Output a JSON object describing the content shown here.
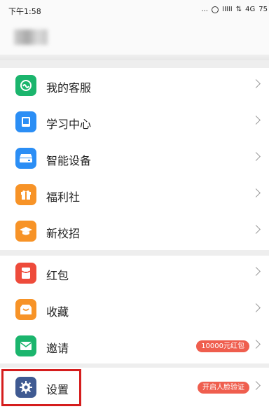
{
  "status_bar": {
    "time": "下午1:58",
    "dots": "...",
    "signal": "IIIII",
    "data_arrows": "⇅",
    "network": "4G",
    "battery": "75"
  },
  "menu": {
    "group1": [
      {
        "label": "我的客服",
        "icon": "customer-service-icon",
        "color": "#1bb56d"
      },
      {
        "label": "学习中心",
        "icon": "book-icon",
        "color": "#2b8ef5"
      },
      {
        "label": "智能设备",
        "icon": "device-icon",
        "color": "#2b8ef5"
      },
      {
        "label": "福利社",
        "icon": "gift-icon",
        "color": "#f79327"
      },
      {
        "label": "新校招",
        "icon": "graduation-cap-icon",
        "color": "#f79327"
      }
    ],
    "group2": [
      {
        "label": "红包",
        "icon": "red-packet-icon",
        "color": "#ee4b3b"
      },
      {
        "label": "收藏",
        "icon": "collection-box-icon",
        "color": "#f79327"
      },
      {
        "label": "邀请",
        "icon": "envelope-icon",
        "color": "#1bb56d",
        "badge": "10000元红包"
      }
    ],
    "group3": [
      {
        "label": "设置",
        "icon": "gear-icon",
        "color": "#3f5a92",
        "badge": "开启人脸验证"
      }
    ]
  }
}
